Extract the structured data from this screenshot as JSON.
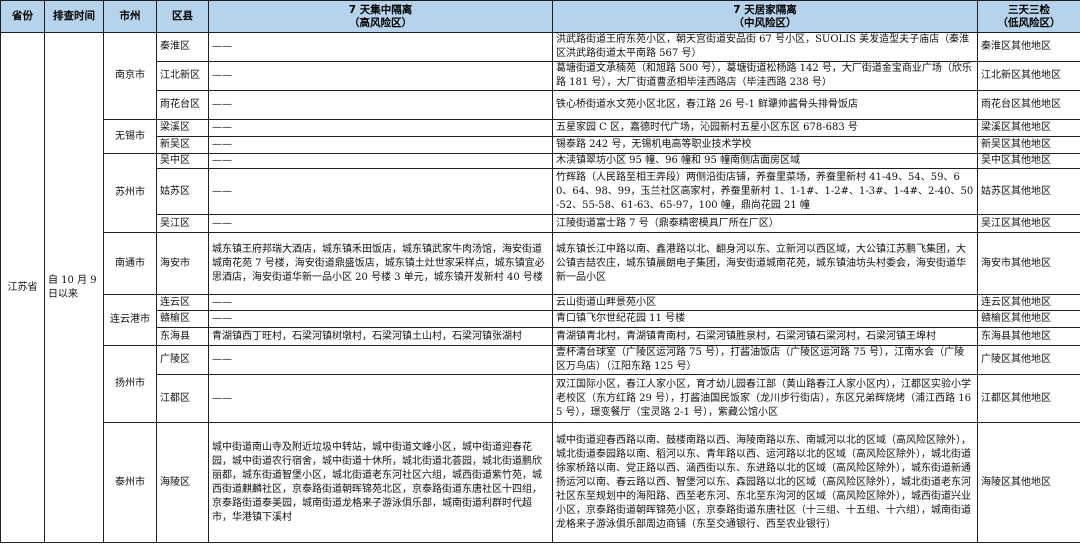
{
  "headers": {
    "province": "省份",
    "time": "排查时间",
    "city": "市州",
    "district": "区县",
    "col1": {
      "title": "7 天集中隔离",
      "sub": "（高风险区）"
    },
    "col2": {
      "title": "7 天居家隔离",
      "sub": "（中风险区）"
    },
    "col3": {
      "title": "三天三检",
      "sub": "（低风险区）"
    }
  },
  "province": "江苏省",
  "time": "自 10 月 9 日以来",
  "cities": {
    "nanjing": "南京市",
    "wuxi": "无锡市",
    "suzhou": "苏州市",
    "nantong": "南通市",
    "lianyungang": "连云港市",
    "yangzhou": "扬州市",
    "taizhou": "泰州市"
  },
  "rows": [
    {
      "district": "秦淮区",
      "high": "——",
      "mid": "洪武路街道王府东苑小区，朝天宫街道安品街 67 号小区，SUOLIS 美发造型夫子庙店（秦淮区洪武路街道太平南路 567 号）",
      "low": "秦淮区其他地区"
    },
    {
      "district": "江北新区",
      "high": "——",
      "mid": "葛塘街道文承楠苑（和旭路 500 号），葛塘街道松杨路 142 号，大厂街道金宝商业广场（欣乐路 181 号），大厂街道曹丞相毕洼西路店（毕洼西路 238 号）",
      "low": "江北新区其他地区"
    },
    {
      "district": "雨花台区",
      "high": "——",
      "mid": "铁心桥街道水文苑小区北区，春江路 26 号-1 鲜犟帅酱骨头排骨饭店",
      "low": "雨花台区其他地区"
    },
    {
      "district": "梁溪区",
      "high": "——",
      "mid": "五星家园 C 区，嘉德时代广场，沁园新村五星小区东区 678-683 号",
      "low": "梁溪区其他地区"
    },
    {
      "district": "新吴区",
      "high": "——",
      "mid": "锡泰路 242 号，无锡机电高等职业技术学校",
      "low": "新吴区其他地区"
    },
    {
      "district": "吴中区",
      "high": "——",
      "mid": "木渎镇翠坊小区 95 幢、96 幢和 95 幢南侧店面房区域",
      "low": "吴中区其他地区"
    },
    {
      "district": "姑苏区",
      "high": "——",
      "mid": "竹辉路（人民路至相王弄段）两侧沿街店铺，养蚕里菜场，养蚕里新村 41-49、54、59、60、64、98、99，玉兰社区高家村，养蚕里新村 1、1-1#、1-2#、1-3#、1-4#、2-40、50-52、55-58、61-63、65-97，100 幢，鼎尚花园 21 幢",
      "low": "姑苏区其他地区"
    },
    {
      "district": "吴江区",
      "high": "——",
      "mid": "江陵街道富士路 7 号（鼎泰精密模具厂所在厂区）",
      "low": "吴江区其他地区"
    },
    {
      "district": "海安市",
      "high": "城东镇王府邦瑞大酒店，城东镇禾田饭店，城东镇武家牛肉汤馆，海安街道城南花苑 7 号楼，海安街道鼎盛饭店，城东镇土灶世家采样点，城东镇宜必思酒店，海安街道华新一品小区 20 号楼 3 单元，城东镇开发新村 40 号楼",
      "mid": "城东镇长江中路以南、鑫港路以北、翻身河以东、立新河以西区域，大公镇江苏鹏飞集团，大公镇吉喆农庄，城东镇晨朗电子集团，海安街道城南花苑，城东镇油坊头村委会，海安街道华新一品小区",
      "low": "海安市其他地区"
    },
    {
      "district": "连云区",
      "high": "——",
      "mid": "云山街道山畔景苑小区",
      "low": "连云区其他地区"
    },
    {
      "district": "赣榆区",
      "high": "——",
      "mid": "青口镇飞尔世纪花园 11 号楼",
      "low": "赣榆区其他地区"
    },
    {
      "district": "东海县",
      "high": "青湖镇西丁旺村，石梁河镇树墩村，石梁河镇土山村，石梁河镇张湖村",
      "mid": "青湖镇青北村，青湖镇青南村，石梁河镇胜泉村，石梁河镇石梁河村，石梁河镇王埠村",
      "low": "东海县其他地区"
    },
    {
      "district": "广陵区",
      "high": "——",
      "mid": "壹杯清台球室（广陵区运河路 75 号），打酱油饭店（广陵区运河路 75 号），江南水会（广陵区万鸟店）（江阳东路 125 号）",
      "low": "广陵区其他地区"
    },
    {
      "district": "江都区",
      "high": "——",
      "mid": "双江国际小区，春江人家小区，育才幼儿园春江部（黄山路春江人家小区内），江都区实验小学老校区（东方红路 29 号），打酱油国民饭家（龙川步行街店），东区兄弟辉烧烤（浦江西路 165 号），璟变餐厅（宝灵路 2-1 号），紫藏公馆小区",
      "low": "江都区其他地区"
    },
    {
      "district": "海陵区",
      "high": "城中街道南山寺及附近垃圾中转站，城中街道文峰小区，城中街道迎春花园，城中街道农行宿舍，城中街道十休所，城北街道北荟园，城北街道鹏欣丽都，城东街道智堡小区，城北街道老东河社区六组，城西街道紫竹苑，城西街道麒麟社区，京泰路街道朝晖锦苑北区，京泰路街道东唐社区十四组，京泰路街道泰美园，城南街道龙格来子游泳俱乐部，城南街道利群时代超市，华港镇下溪村",
      "mid": "城中街道迎春西路以南、鼓楼南路以西、海陵南路以东、南城河以北的区域（高风险区除外），城北街道泰园路以南、稻河以东、青年路以西、运河路以北的区域（高风险区除外），城北街道徐家桥路以南、党正路以西、涵西街以东、东进路以北的区域（高风险区除外），城东街道新通扬运河以南、春云路以西、智堡河以东、森园路以北的区域（高风险区除外），城北街道老东河社区东至规划中的海阳路、西至老东河、东北至东沟河的区域（高风险区除外），城西街道兴业小区，京泰路街道朝晖锦苑小区，京泰路街道东唐社区（十三组、十五组、十六组），城南街道龙格来子游泳俱乐部周边商铺（东至交通银行、西至农业银行）",
      "low": "海陵区其他地区"
    }
  ]
}
